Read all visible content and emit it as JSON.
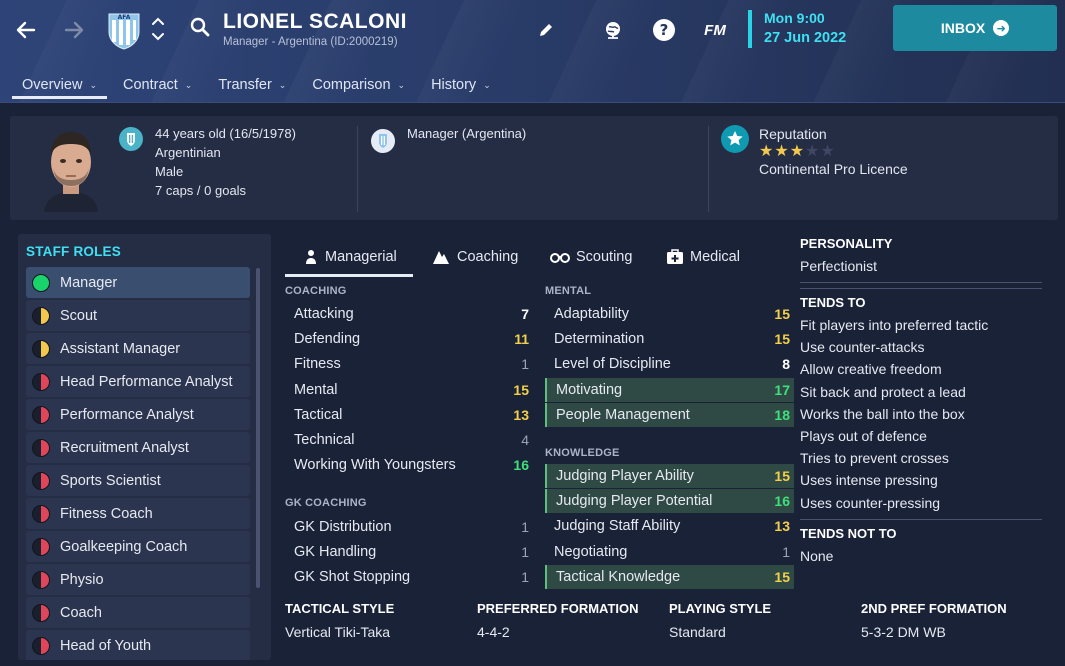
{
  "header": {
    "name": "LIONEL SCALONI",
    "subtitle": "Manager - Argentina (ID:2000219)",
    "date_time": "Mon 9:00",
    "date_day": "27 Jun 2022",
    "fm_label": "FM",
    "inbox_label": "INBOX",
    "accent": "#3ee0f2",
    "inbox_color": "#1d8aa0"
  },
  "tabs": [
    {
      "label": "Overview",
      "active": true
    },
    {
      "label": "Contract"
    },
    {
      "label": "Transfer"
    },
    {
      "label": "Comparison"
    },
    {
      "label": "History"
    }
  ],
  "info": {
    "age": "44 years old (16/5/1978)",
    "nationality": "Argentinian",
    "gender": "Male",
    "caps": "7 caps / 0 goals",
    "job": "Manager (Argentina)",
    "reputation_label": "Reputation",
    "reputation_stars": 3,
    "reputation_max": 5,
    "licence": "Continental Pro Licence"
  },
  "staff_roles": {
    "title": "STAFF ROLES",
    "items": [
      {
        "label": "Manager",
        "status": "green"
      },
      {
        "label": "Scout",
        "status": "half"
      },
      {
        "label": "Assistant Manager",
        "status": "half"
      },
      {
        "label": "Head Performance Analyst",
        "status": "red"
      },
      {
        "label": "Performance Analyst",
        "status": "red"
      },
      {
        "label": "Recruitment Analyst",
        "status": "red"
      },
      {
        "label": "Sports Scientist",
        "status": "red"
      },
      {
        "label": "Fitness Coach",
        "status": "red"
      },
      {
        "label": "Goalkeeping Coach",
        "status": "red"
      },
      {
        "label": "Physio",
        "status": "red"
      },
      {
        "label": "Coach",
        "status": "red"
      },
      {
        "label": "Head of Youth",
        "status": "red"
      }
    ]
  },
  "attr_tabs": [
    {
      "label": "Managerial",
      "icon": "manager-icon"
    },
    {
      "label": "Coaching",
      "icon": "coaching-icon"
    },
    {
      "label": "Scouting",
      "icon": "binoculars-icon"
    },
    {
      "label": "Medical",
      "icon": "medical-icon"
    }
  ],
  "attributes": {
    "coaching_title": "COACHING",
    "coaching": [
      {
        "label": "Attacking",
        "value": "7",
        "color": "white"
      },
      {
        "label": "Defending",
        "value": "11",
        "color": "yellow"
      },
      {
        "label": "Fitness",
        "value": "1",
        "color": "grey"
      },
      {
        "label": "Mental",
        "value": "15",
        "color": "yellow"
      },
      {
        "label": "Tactical",
        "value": "13",
        "color": "yellow"
      },
      {
        "label": "Technical",
        "value": "4",
        "color": "grey"
      },
      {
        "label": "Working With Youngsters",
        "value": "16",
        "color": "green"
      }
    ],
    "gk_title": "GK COACHING",
    "gk": [
      {
        "label": "GK Distribution",
        "value": "1",
        "color": "grey"
      },
      {
        "label": "GK Handling",
        "value": "1",
        "color": "grey"
      },
      {
        "label": "GK Shot Stopping",
        "value": "1",
        "color": "grey"
      }
    ],
    "mental_title": "MENTAL",
    "mental": [
      {
        "label": "Adaptability",
        "value": "15",
        "color": "yellow"
      },
      {
        "label": "Determination",
        "value": "15",
        "color": "yellow"
      },
      {
        "label": "Level of Discipline",
        "value": "8",
        "color": "white"
      },
      {
        "label": "Motivating",
        "value": "17",
        "color": "green",
        "hl": true
      },
      {
        "label": "People Management",
        "value": "18",
        "color": "green",
        "hl": true
      }
    ],
    "knowledge_title": "KNOWLEDGE",
    "knowledge": [
      {
        "label": "Judging Player Ability",
        "value": "15",
        "color": "yellow",
        "hl": true
      },
      {
        "label": "Judging Player Potential",
        "value": "16",
        "color": "green",
        "hl": true
      },
      {
        "label": "Judging Staff Ability",
        "value": "13",
        "color": "yellow"
      },
      {
        "label": "Negotiating",
        "value": "1",
        "color": "grey"
      },
      {
        "label": "Tactical Knowledge",
        "value": "15",
        "color": "yellow",
        "hl": true
      }
    ]
  },
  "personality": {
    "title": "PERSONALITY",
    "value": "Perfectionist",
    "tends_title": "TENDS TO",
    "tends": [
      "Fit players into preferred tactic",
      "Use counter-attacks",
      "Allow creative freedom",
      "Sit back and protect a lead",
      "Works the ball into the box",
      "Plays out of defence",
      "Tries to prevent crosses",
      "Uses intense pressing",
      "Uses counter-pressing"
    ],
    "not_title": "TENDS NOT TO",
    "not_value": "None"
  },
  "tactical": [
    {
      "label": "TACTICAL STYLE",
      "value": "Vertical Tiki-Taka"
    },
    {
      "label": "PREFERRED FORMATION",
      "value": "4-4-2"
    },
    {
      "label": "PLAYING STYLE",
      "value": "Standard"
    },
    {
      "label": "2ND PREF FORMATION",
      "value": "5-3-2 DM WB"
    }
  ]
}
